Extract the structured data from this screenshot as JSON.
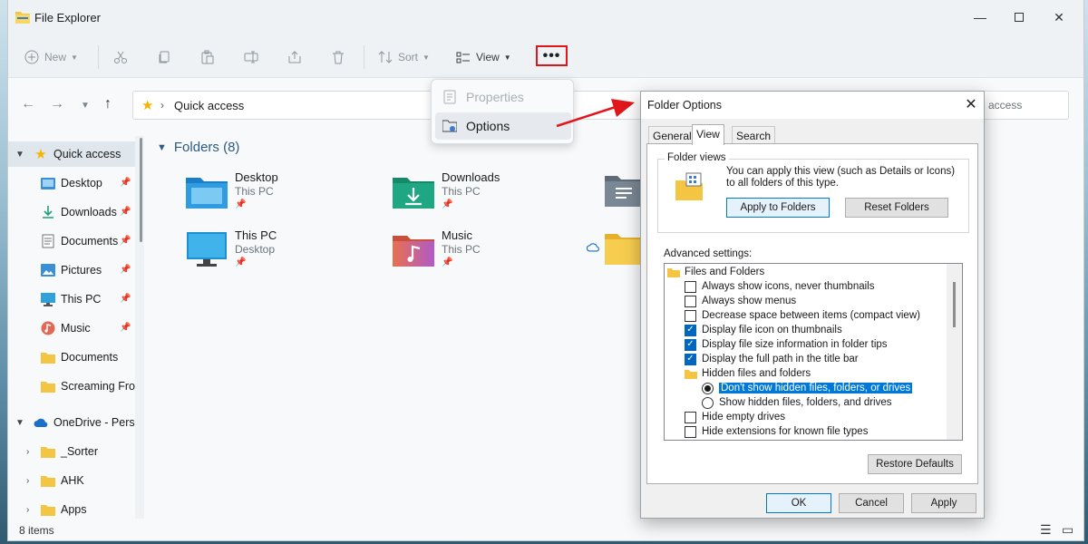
{
  "window": {
    "title": "File Explorer"
  },
  "toolbar": {
    "new": "New",
    "sort": "Sort",
    "view": "View",
    "more": "•••"
  },
  "address": {
    "location": "Quick access",
    "search_partial": "access"
  },
  "sidebar": {
    "items": [
      {
        "label": "Quick access",
        "icon": "star-icon",
        "pinned": false,
        "expander": "expanded"
      },
      {
        "label": "Desktop",
        "icon": "desktop-folder-icon",
        "pinned": true
      },
      {
        "label": "Downloads",
        "icon": "download-icon",
        "pinned": true
      },
      {
        "label": "Documents",
        "icon": "documents-icon",
        "pinned": true
      },
      {
        "label": "Pictures",
        "icon": "pictures-icon",
        "pinned": true
      },
      {
        "label": "This PC",
        "icon": "monitor-icon",
        "pinned": true
      },
      {
        "label": "Music",
        "icon": "music-icon",
        "pinned": true
      },
      {
        "label": "Documents",
        "icon": "folder-icon",
        "pinned": false
      },
      {
        "label": "Screaming Frog",
        "icon": "folder-icon",
        "pinned": false
      },
      {
        "label": "OneDrive - Perso",
        "icon": "cloud-icon",
        "pinned": false,
        "expander": "expanded"
      },
      {
        "label": "_Sorter",
        "icon": "folder-icon",
        "pinned": false,
        "expander": "collapsed"
      },
      {
        "label": "AHK",
        "icon": "folder-icon",
        "pinned": false,
        "expander": "collapsed"
      },
      {
        "label": "Apps",
        "icon": "folder-icon",
        "pinned": false,
        "expander": "collapsed"
      }
    ]
  },
  "main": {
    "section_title": "Folders (8)",
    "folders": [
      {
        "name": "Desktop",
        "sub": "This PC",
        "icon": "desktop-folder-icon"
      },
      {
        "name": "Downloads",
        "sub": "This PC",
        "icon": "downloads-folder-icon"
      },
      {
        "name": "This PC",
        "sub": "Desktop",
        "icon": "monitor-icon"
      },
      {
        "name": "Music",
        "sub": "This PC",
        "icon": "music-folder-icon"
      }
    ]
  },
  "status": {
    "items": "8 items"
  },
  "menu": {
    "properties": "Properties",
    "options": "Options"
  },
  "dialog": {
    "title": "Folder Options",
    "tabs": [
      "General",
      "View",
      "Search"
    ],
    "folder_views_label": "Folder views",
    "folder_views_text": "You can apply this view (such as Details or Icons) to all folders of this type.",
    "apply_to_folders": "Apply to Folders",
    "reset_folders": "Reset Folders",
    "advanced_label": "Advanced settings:",
    "tree": [
      {
        "type": "folder",
        "label": "Files and Folders",
        "level": 0
      },
      {
        "type": "checkbox",
        "label": "Always show icons, never thumbnails",
        "checked": false,
        "level": 1
      },
      {
        "type": "checkbox",
        "label": "Always show menus",
        "checked": false,
        "level": 1
      },
      {
        "type": "checkbox",
        "label": "Decrease space between items (compact view)",
        "checked": false,
        "level": 1
      },
      {
        "type": "checkbox",
        "label": "Display file icon on thumbnails",
        "checked": true,
        "level": 1
      },
      {
        "type": "checkbox",
        "label": "Display file size information in folder tips",
        "checked": true,
        "level": 1
      },
      {
        "type": "checkbox",
        "label": "Display the full path in the title bar",
        "checked": true,
        "level": 1
      },
      {
        "type": "folder",
        "label": "Hidden files and folders",
        "level": 1
      },
      {
        "type": "radio",
        "label": "Don't show hidden files, folders, or drives",
        "checked": true,
        "level": 2,
        "highlighted": true
      },
      {
        "type": "radio",
        "label": "Show hidden files, folders, and drives",
        "checked": false,
        "level": 2
      },
      {
        "type": "checkbox",
        "label": "Hide empty drives",
        "checked": false,
        "level": 1
      },
      {
        "type": "checkbox",
        "label": "Hide extensions for known file types",
        "checked": false,
        "level": 1
      }
    ],
    "restore_defaults": "Restore Defaults",
    "ok": "OK",
    "cancel": "Cancel",
    "apply": "Apply"
  },
  "colors": {
    "accent": "#0078d7",
    "highlight_box": "#e0161b",
    "folder": "#f4c542"
  }
}
